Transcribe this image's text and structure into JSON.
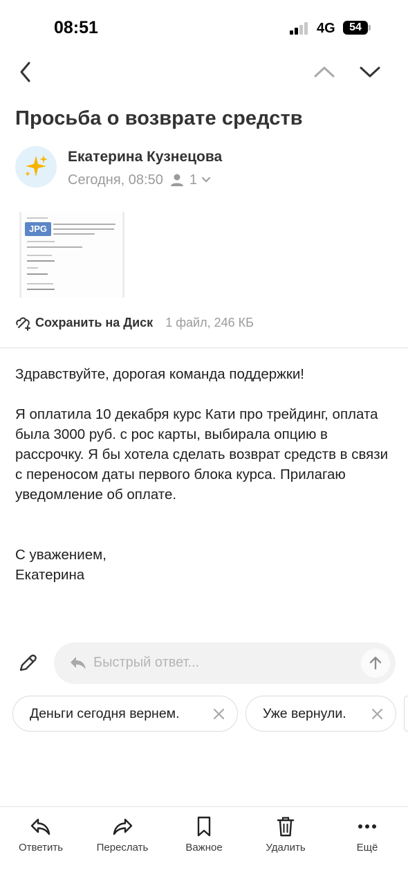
{
  "status_bar": {
    "time": "08:51",
    "network": "4G",
    "battery": "54"
  },
  "nav": {
    "back_icon": "chevron-left-icon",
    "prev_icon": "chevron-up-icon",
    "next_icon": "chevron-down-icon"
  },
  "message": {
    "subject": "Просьба о возврате средств",
    "sender_name": "Екатерина Кузнецова",
    "avatar_icon": "sparkles-icon",
    "date": "Сегодня, 08:50",
    "recipients_count": "1"
  },
  "attachment": {
    "type_badge": "JPG",
    "save_label": "Сохранить на Диск",
    "meta": "1 файл, 246 КБ"
  },
  "body": {
    "greeting": "Здравствуйте, дорогая команда поддержки!",
    "paragraph": "Я оплатила 10 декабря курс Кати про трейдинг, оплата была 3000 руб. с рос карты, выбирала опцию в рассрочку. Я бы хотела сделать возврат средств в связи с переносом даты первого блока курса. Прилагаю уведомление об оплате.",
    "signoff": "С уважением,",
    "signature": "Екатерина"
  },
  "quick_reply": {
    "placeholder": "Быстрый ответ...",
    "suggestions": [
      "Деньги сегодня вернем.",
      "Уже вернули."
    ]
  },
  "tabbar": {
    "reply": "Ответить",
    "forward": "Переслать",
    "important": "Важное",
    "delete": "Удалить",
    "more": "Ещё"
  },
  "colors": {
    "text": "#1f1f1f",
    "muted": "#9b9b9b",
    "badge": "#5b86c7",
    "chip_border": "#dcdcdc"
  }
}
